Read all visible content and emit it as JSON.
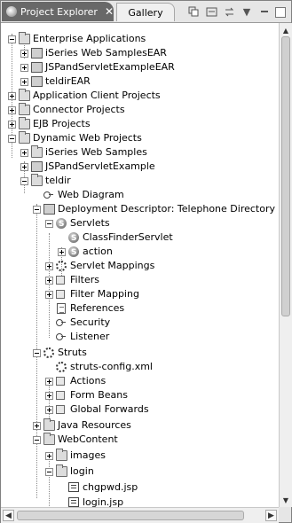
{
  "tabs": {
    "project_explorer": "Project Explorer",
    "close_glyph": "✕",
    "gallery": "Gallery"
  },
  "toolbar": {
    "menu_glyph": "▼"
  },
  "tree": {
    "enterprise_applications": "Enterprise Applications",
    "iseries_web_samples_ear": "iSeries Web SamplesEAR",
    "jsp_servlet_example_ear": "JSPandServletExampleEAR",
    "teldir_ear": "teldirEAR",
    "application_client_projects": "Application Client Projects",
    "connector_projects": "Connector Projects",
    "ejb_projects": "EJB Projects",
    "dynamic_web_projects": "Dynamic Web Projects",
    "iseries_web_samples": "iSeries Web Samples",
    "jsp_servlet_example": "JSPandServletExample",
    "teldir": "teldir",
    "web_diagram": "Web Diagram",
    "deployment_descriptor": "Deployment Descriptor: Telephone Directory",
    "servlets": "Servlets",
    "class_finder_servlet": "ClassFinderServlet",
    "action": "action",
    "servlet_mappings": "Servlet Mappings",
    "filters": "Filters",
    "filter_mapping": "Filter Mapping",
    "references": "References",
    "security": "Security",
    "listener": "Listener",
    "struts": "Struts",
    "struts_config": "struts-config.xml",
    "actions": "Actions",
    "form_beans": "Form Beans",
    "global_forwards": "Global Forwards",
    "java_resources": "Java Resources",
    "web_content": "WebContent",
    "images": "images",
    "login": "login",
    "chgpwd_jsp": "chgpwd.jsp",
    "login_jsp": "login.jsp"
  },
  "scrollbars": {
    "up": "▲",
    "down": "▼",
    "left": "◀",
    "right": "▶"
  }
}
